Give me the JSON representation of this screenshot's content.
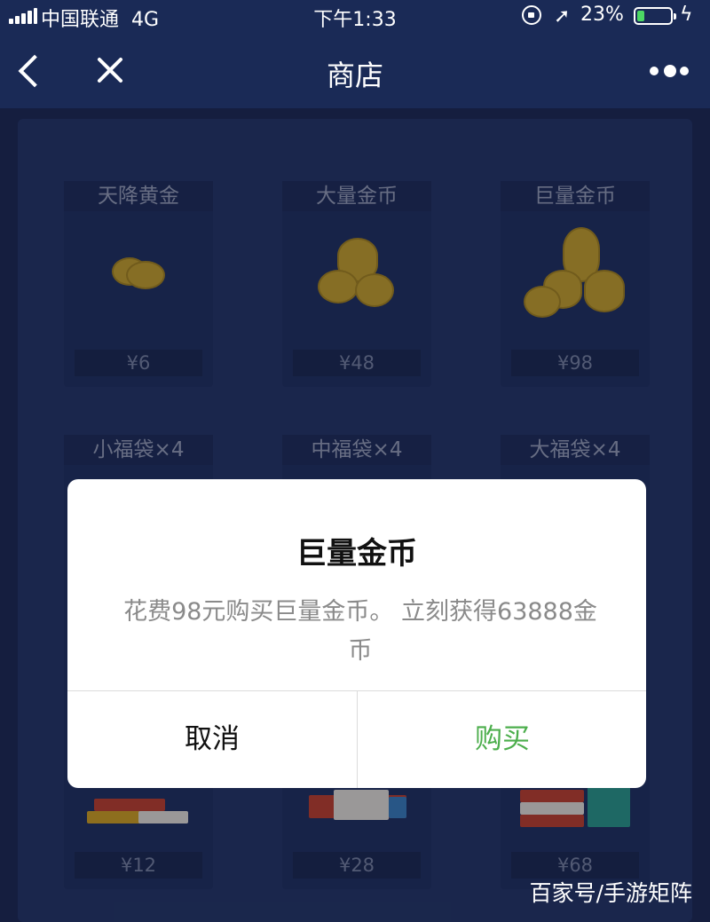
{
  "status_bar": {
    "carrier": "中国联通",
    "network": "4G",
    "time": "下午1:33",
    "battery_percent": "23%",
    "battery_level": 0.23
  },
  "nav": {
    "title": "商店"
  },
  "shop": {
    "items": [
      {
        "name": "天降黄金",
        "price": "¥6"
      },
      {
        "name": "大量金币",
        "price": "¥48"
      },
      {
        "name": "巨量金币",
        "price": "¥98"
      },
      {
        "name": "小福袋×4",
        "price": "¥12"
      },
      {
        "name": "中福袋×4",
        "price": "¥28"
      },
      {
        "name": "大福袋×4",
        "price": "¥68"
      }
    ]
  },
  "dialog": {
    "title": "巨量金币",
    "message": "花费98元购买巨量金币。 立刻获得63888金币",
    "cancel_label": "取消",
    "confirm_label": "购买"
  },
  "watermark": "百家号/手游矩阵",
  "colors": {
    "background": "#1c2852",
    "confirm": "#4cae4c",
    "battery": "#4cd964"
  }
}
